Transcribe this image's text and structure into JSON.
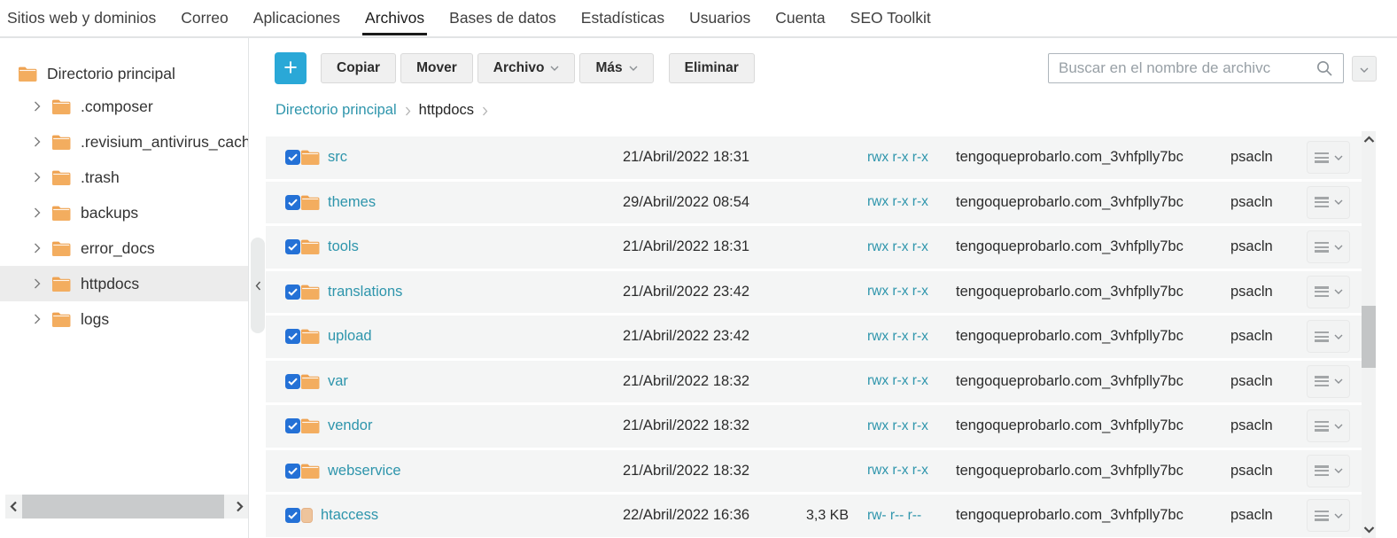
{
  "nav": {
    "items": [
      {
        "label": "Sitios web y dominios",
        "active": false
      },
      {
        "label": "Correo",
        "active": false
      },
      {
        "label": "Aplicaciones",
        "active": false
      },
      {
        "label": "Archivos",
        "active": true
      },
      {
        "label": "Bases de datos",
        "active": false
      },
      {
        "label": "Estadísticas",
        "active": false
      },
      {
        "label": "Usuarios",
        "active": false
      },
      {
        "label": "Cuenta",
        "active": false
      },
      {
        "label": "SEO Toolkit",
        "active": false
      }
    ]
  },
  "sidebar": {
    "root_label": "Directorio principal",
    "items": [
      {
        "label": ".composer",
        "selected": false
      },
      {
        "label": ".revisium_antivirus_cach",
        "selected": false
      },
      {
        "label": ".trash",
        "selected": false
      },
      {
        "label": "backups",
        "selected": false
      },
      {
        "label": "error_docs",
        "selected": false
      },
      {
        "label": "httpdocs",
        "selected": true
      },
      {
        "label": "logs",
        "selected": false
      }
    ]
  },
  "toolbar": {
    "add_label": "+",
    "buttons": [
      {
        "label": "Copiar",
        "dropdown": false,
        "spaced": false
      },
      {
        "label": "Mover",
        "dropdown": false,
        "spaced": false
      },
      {
        "label": "Archivo",
        "dropdown": true,
        "spaced": false
      },
      {
        "label": "Más",
        "dropdown": true,
        "spaced": false
      },
      {
        "label": "Eliminar",
        "dropdown": false,
        "spaced": true
      }
    ],
    "search_placeholder": "Buscar en el nombre de archivc"
  },
  "breadcrumb": {
    "links": [
      "Directorio principal"
    ],
    "current": "httpdocs"
  },
  "file_list": {
    "rows": [
      {
        "name": "src",
        "type": "folder",
        "modified": "21/Abril/2022 18:31",
        "size": "",
        "permissions": "rwx r-x r-x",
        "user": "tengoqueprobarlo.com_3vhfplly7bc",
        "group": "psacln"
      },
      {
        "name": "themes",
        "type": "folder",
        "modified": "29/Abril/2022 08:54",
        "size": "",
        "permissions": "rwx r-x r-x",
        "user": "tengoqueprobarlo.com_3vhfplly7bc",
        "group": "psacln"
      },
      {
        "name": "tools",
        "type": "folder",
        "modified": "21/Abril/2022 18:31",
        "size": "",
        "permissions": "rwx r-x r-x",
        "user": "tengoqueprobarlo.com_3vhfplly7bc",
        "group": "psacln"
      },
      {
        "name": "translations",
        "type": "folder",
        "modified": "21/Abril/2022 23:42",
        "size": "",
        "permissions": "rwx r-x r-x",
        "user": "tengoqueprobarlo.com_3vhfplly7bc",
        "group": "psacln"
      },
      {
        "name": "upload",
        "type": "folder",
        "modified": "21/Abril/2022 23:42",
        "size": "",
        "permissions": "rwx r-x r-x",
        "user": "tengoqueprobarlo.com_3vhfplly7bc",
        "group": "psacln"
      },
      {
        "name": "var",
        "type": "folder",
        "modified": "21/Abril/2022 18:32",
        "size": "",
        "permissions": "rwx r-x r-x",
        "user": "tengoqueprobarlo.com_3vhfplly7bc",
        "group": "psacln"
      },
      {
        "name": "vendor",
        "type": "folder",
        "modified": "21/Abril/2022 18:32",
        "size": "",
        "permissions": "rwx r-x r-x",
        "user": "tengoqueprobarlo.com_3vhfplly7bc",
        "group": "psacln"
      },
      {
        "name": "webservice",
        "type": "folder",
        "modified": "21/Abril/2022 18:32",
        "size": "",
        "permissions": "rwx r-x r-x",
        "user": "tengoqueprobarlo.com_3vhfplly7bc",
        "group": "psacln"
      },
      {
        "name": "htaccess",
        "type": "file",
        "modified": "22/Abril/2022 16:36",
        "size": "3,3 KB",
        "permissions": "rw- r-- r--",
        "user": "tengoqueprobarlo.com_3vhfplly7bc",
        "group": "psacln"
      }
    ]
  },
  "colors": {
    "accent_blue": "#2aa8d7",
    "link_teal": "#2e95ac",
    "checkbox_blue": "#2471d6",
    "folder_orange": "#efa352",
    "active_tab_underline": "#1b1b1b",
    "row_background": "#f4f5f5"
  }
}
